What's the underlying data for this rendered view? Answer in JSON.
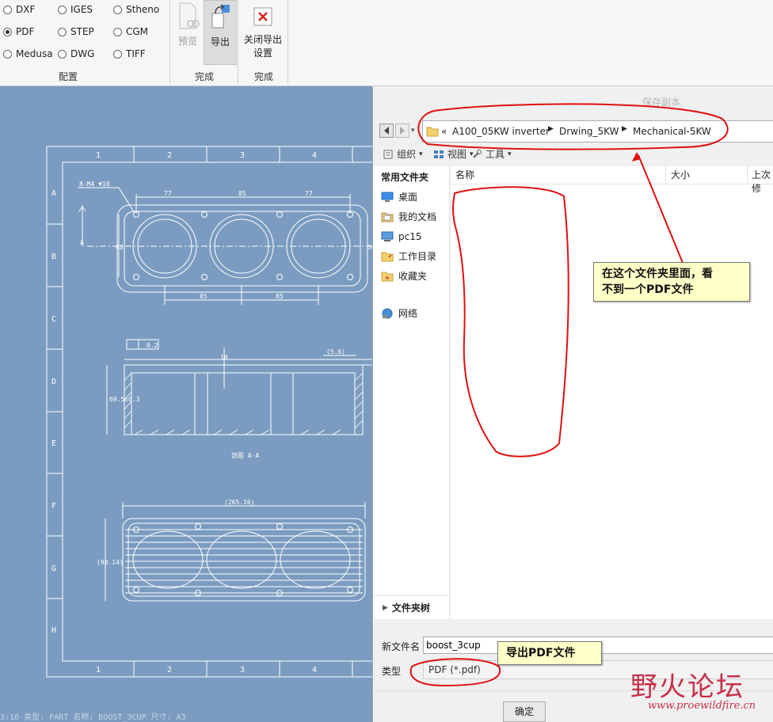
{
  "ribbon": {
    "formats": [
      {
        "label": "DXF",
        "selected": false
      },
      {
        "label": "IGES",
        "selected": false
      },
      {
        "label": "Stheno",
        "selected": false
      },
      {
        "label": "PDF",
        "selected": true
      },
      {
        "label": "STEP",
        "selected": false
      },
      {
        "label": "CGM",
        "selected": false
      },
      {
        "label": "Medusa",
        "selected": false
      },
      {
        "label": "DWG",
        "selected": false
      },
      {
        "label": "TIFF",
        "selected": false
      }
    ],
    "config_label": "配置",
    "preview_label": "预览",
    "export_label": "导出",
    "finish_label_1": "完成",
    "close_export_line1": "关闭导出",
    "close_export_line2": "设置",
    "finish_label_2": "完成"
  },
  "drawing": {
    "col_labels": [
      "1",
      "2",
      "3",
      "4"
    ],
    "row_labels": [
      "A",
      "B",
      "C",
      "D",
      "E",
      "F",
      "G",
      "H"
    ],
    "hole_note": "8-M4 ▼10",
    "dims_top": [
      "77",
      "85",
      "77"
    ],
    "dims_bottom": [
      "85",
      "85"
    ],
    "dim_height": "68",
    "dim_right": "50",
    "flatness": "0.2",
    "dim_ten": "10",
    "dim_56": "(5.6)",
    "dim_depth": "69.5±0.3",
    "section_label": "剖面 A-A",
    "dim_length": "(265.16)",
    "dim_width": "(98.14)",
    "status": "3:10    类型: PART   名称: BOOST_3CUP   尺寸: A3"
  },
  "dialog": {
    "title": "保存副本",
    "breadcrumb": [
      "A100_05KW inverter",
      "Drwing_5KW",
      "Mechanical-5KW"
    ],
    "breadcrumb_prefix": "«",
    "toolbar": {
      "organize": "组织",
      "view": "视图",
      "tools": "工具"
    },
    "nav": {
      "header": "常用文件夹",
      "items": [
        "桌面",
        "我的文档",
        "pc15",
        "工作目录",
        "收藏夹"
      ],
      "network": "网络",
      "folder_tree": "文件夹树"
    },
    "columns": {
      "name": "名称",
      "size": "大小",
      "modified": "上次修"
    },
    "filename_label": "新文件名",
    "filename_value": "boost_3cup",
    "type_label": "类型",
    "type_value": "PDF (*.pdf)",
    "ok_button": "确定"
  },
  "annotations": {
    "callout_folder_line1": "在这个文件夹里面，看",
    "callout_folder_line2": "不到一个PDF文件",
    "callout_export": "导出PDF文件"
  },
  "watermark": {
    "logo_text": "野火论坛",
    "url": "www.proewildfire.cn"
  },
  "colors": {
    "canvas": "#7b9cc0",
    "annotation": "#e01010",
    "callout_bg": "#ffffc8",
    "watermark": "#c6304a"
  }
}
